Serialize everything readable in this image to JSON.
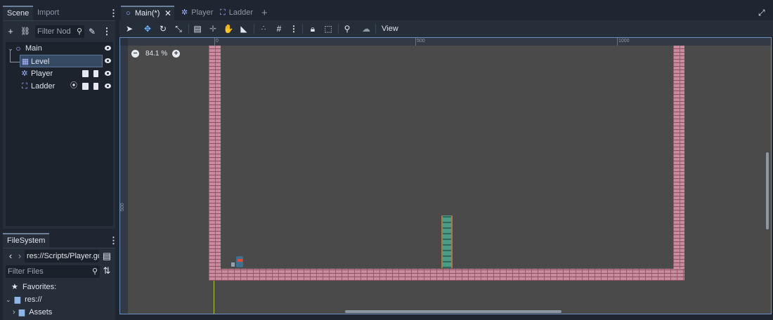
{
  "scene_dock": {
    "tabs": {
      "scene": "Scene",
      "import": "Import"
    },
    "filter_placeholder": "Filter Nod",
    "tree": [
      {
        "label": "Main",
        "icon": "node2d-circle-icon",
        "visible": true
      },
      {
        "label": "Level",
        "icon": "tilemap-grid-icon",
        "visible": true,
        "selected": true
      },
      {
        "label": "Player",
        "icon": "character-body-icon",
        "visible": true,
        "badges": [
          "clapperboard-icon",
          "script-icon"
        ]
      },
      {
        "label": "Ladder",
        "icon": "area-icon",
        "visible": true,
        "badges": [
          "signal-icon",
          "clapperboard-icon",
          "script-icon"
        ]
      }
    ]
  },
  "filesystem_dock": {
    "tab": "FileSystem",
    "path": "res://Scripts/Player.gd",
    "filter_placeholder": "Filter Files",
    "items": {
      "favorites": "Favorites:",
      "res": "res://",
      "assets": "Assets"
    }
  },
  "editor_tabs": [
    {
      "label": "Main(*)",
      "icon": "node2d-circle-icon",
      "active": true
    },
    {
      "label": "Player",
      "icon": "character-body-icon",
      "active": false
    },
    {
      "label": "Ladder",
      "icon": "area-icon",
      "active": false
    }
  ],
  "toolbar": {
    "view_label": "View"
  },
  "viewport": {
    "zoom_label": "84.1 %",
    "ruler_top_labels": [
      "0",
      "500",
      "1000"
    ],
    "ruler_left_labels": [
      "500"
    ]
  },
  "colors": {
    "accent": "#6fb3ff",
    "selection": "#364a63",
    "brick": "#c98b9e",
    "viewport_bg": "#4a4a4a"
  }
}
